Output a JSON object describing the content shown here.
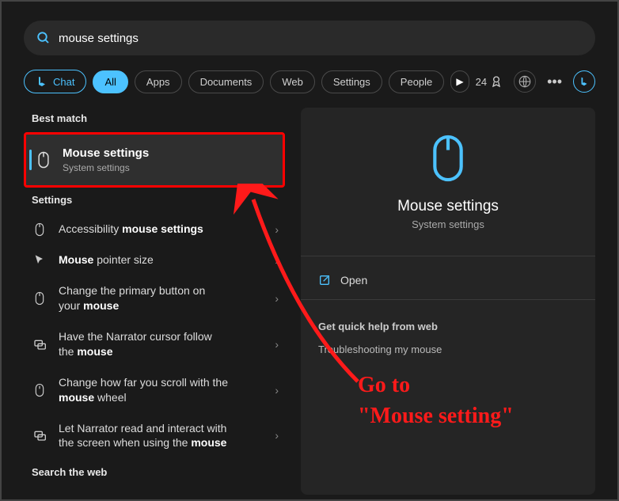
{
  "search": {
    "value": "mouse settings"
  },
  "filters": {
    "chat": "Chat",
    "all": "All",
    "apps": "Apps",
    "documents": "Documents",
    "web": "Web",
    "settings": "Settings",
    "people": "People"
  },
  "header_right": {
    "rewards_count": "24"
  },
  "left": {
    "best_match_header": "Best match",
    "best_item": {
      "title": "Mouse settings",
      "subtitle": "System settings"
    },
    "settings_header": "Settings",
    "items": [
      {
        "prefix": "Accessibility ",
        "bold": "mouse settings"
      },
      {
        "boldPrefix": "Mouse",
        "suffix": " pointer size"
      },
      {
        "line1": "Change the primary button on",
        "line2prefix": "your ",
        "line2bold": "mouse"
      },
      {
        "line1": "Have the Narrator cursor follow",
        "line2prefix": "the ",
        "line2bold": "mouse"
      },
      {
        "line1": "Change how far you scroll with the",
        "line2bold": "mouse",
        "line2suffix": " wheel"
      },
      {
        "line1": "Let Narrator read and interact with",
        "line2prefix": "the screen when using the ",
        "line2bold": "mouse"
      }
    ],
    "search_web_header": "Search the web"
  },
  "preview": {
    "title": "Mouse settings",
    "subtitle": "System settings",
    "open": "Open",
    "help_header": "Get quick help from web",
    "help_link": "Troubleshooting my mouse"
  },
  "annotation": {
    "line1": "Go to",
    "line2": "\"Mouse setting\""
  }
}
